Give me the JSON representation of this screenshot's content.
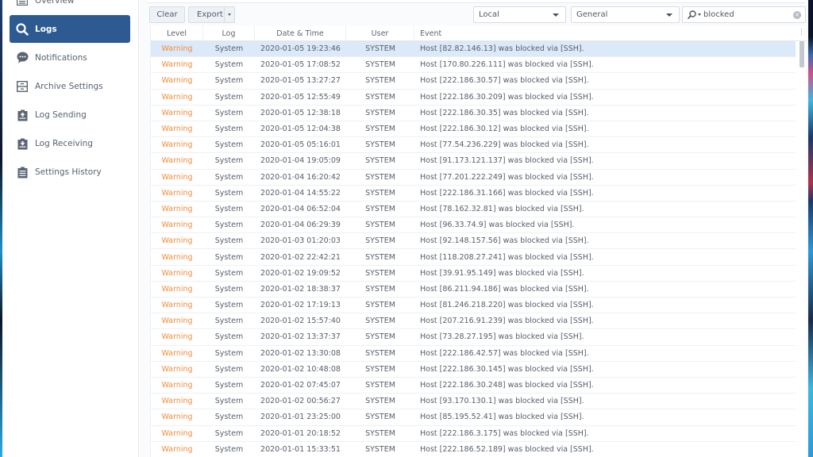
{
  "sidebar": {
    "items": [
      {
        "label": "Overview",
        "icon": "overview-icon",
        "active": false
      },
      {
        "label": "Logs",
        "icon": "search-icon",
        "active": true
      },
      {
        "label": "Notifications",
        "icon": "speech-bubble-icon",
        "active": false
      },
      {
        "label": "Archive Settings",
        "icon": "archive-drawer-icon",
        "active": false
      },
      {
        "label": "Log Sending",
        "icon": "clipboard-upload-icon",
        "active": false
      },
      {
        "label": "Log Receiving",
        "icon": "clipboard-download-icon",
        "active": false
      },
      {
        "label": "Settings History",
        "icon": "clipboard-list-icon",
        "active": false
      }
    ]
  },
  "toolbar": {
    "clear_label": "Clear",
    "export_label": "Export",
    "source_select": "Local",
    "type_select": "General",
    "search_value": "blocked",
    "search_placeholder": "Search"
  },
  "colors": {
    "accent": "#2c5a91",
    "warning": "#f08c3a",
    "selected_row": "#dce9f8"
  },
  "grid": {
    "columns": [
      "Level",
      "Log",
      "Date & Time",
      "User",
      "Event"
    ],
    "rows": [
      {
        "level": "Warning",
        "log": "System",
        "datetime": "2020-01-05 19:23:46",
        "user": "SYSTEM",
        "event": "Host [82.82.146.13] was blocked via [SSH]."
      },
      {
        "level": "Warning",
        "log": "System",
        "datetime": "2020-01-05 17:08:52",
        "user": "SYSTEM",
        "event": "Host [170.80.226.111] was blocked via [SSH]."
      },
      {
        "level": "Warning",
        "log": "System",
        "datetime": "2020-01-05 13:27:27",
        "user": "SYSTEM",
        "event": "Host [222.186.30.57] was blocked via [SSH]."
      },
      {
        "level": "Warning",
        "log": "System",
        "datetime": "2020-01-05 12:55:49",
        "user": "SYSTEM",
        "event": "Host [222.186.30.209] was blocked via [SSH]."
      },
      {
        "level": "Warning",
        "log": "System",
        "datetime": "2020-01-05 12:38:18",
        "user": "SYSTEM",
        "event": "Host [222.186.30.35] was blocked via [SSH]."
      },
      {
        "level": "Warning",
        "log": "System",
        "datetime": "2020-01-05 12:04:38",
        "user": "SYSTEM",
        "event": "Host [222.186.30.12] was blocked via [SSH]."
      },
      {
        "level": "Warning",
        "log": "System",
        "datetime": "2020-01-05 05:16:01",
        "user": "SYSTEM",
        "event": "Host [77.54.236.229] was blocked via [SSH]."
      },
      {
        "level": "Warning",
        "log": "System",
        "datetime": "2020-01-04 19:05:09",
        "user": "SYSTEM",
        "event": "Host [91.173.121.137] was blocked via [SSH]."
      },
      {
        "level": "Warning",
        "log": "System",
        "datetime": "2020-01-04 16:20:42",
        "user": "SYSTEM",
        "event": "Host [77.201.222.249] was blocked via [SSH]."
      },
      {
        "level": "Warning",
        "log": "System",
        "datetime": "2020-01-04 14:55:22",
        "user": "SYSTEM",
        "event": "Host [222.186.31.166] was blocked via [SSH]."
      },
      {
        "level": "Warning",
        "log": "System",
        "datetime": "2020-01-04 06:52:04",
        "user": "SYSTEM",
        "event": "Host [78.162.32.81] was blocked via [SSH]."
      },
      {
        "level": "Warning",
        "log": "System",
        "datetime": "2020-01-04 06:29:39",
        "user": "SYSTEM",
        "event": "Host [96.33.74.9] was blocked via [SSH]."
      },
      {
        "level": "Warning",
        "log": "System",
        "datetime": "2020-01-03 01:20:03",
        "user": "SYSTEM",
        "event": "Host [92.148.157.56] was blocked via [SSH]."
      },
      {
        "level": "Warning",
        "log": "System",
        "datetime": "2020-01-02 22:42:21",
        "user": "SYSTEM",
        "event": "Host [118.208.27.241] was blocked via [SSH]."
      },
      {
        "level": "Warning",
        "log": "System",
        "datetime": "2020-01-02 19:09:52",
        "user": "SYSTEM",
        "event": "Host [39.91.95.149] was blocked via [SSH]."
      },
      {
        "level": "Warning",
        "log": "System",
        "datetime": "2020-01-02 18:38:37",
        "user": "SYSTEM",
        "event": "Host [86.211.94.186] was blocked via [SSH]."
      },
      {
        "level": "Warning",
        "log": "System",
        "datetime": "2020-01-02 17:19:13",
        "user": "SYSTEM",
        "event": "Host [81.246.218.220] was blocked via [SSH]."
      },
      {
        "level": "Warning",
        "log": "System",
        "datetime": "2020-01-02 15:57:40",
        "user": "SYSTEM",
        "event": "Host [207.216.91.239] was blocked via [SSH]."
      },
      {
        "level": "Warning",
        "log": "System",
        "datetime": "2020-01-02 13:37:37",
        "user": "SYSTEM",
        "event": "Host [73.28.27.195] was blocked via [SSH]."
      },
      {
        "level": "Warning",
        "log": "System",
        "datetime": "2020-01-02 13:30:08",
        "user": "SYSTEM",
        "event": "Host [222.186.42.57] was blocked via [SSH]."
      },
      {
        "level": "Warning",
        "log": "System",
        "datetime": "2020-01-02 10:48:08",
        "user": "SYSTEM",
        "event": "Host [222.186.30.145] was blocked via [SSH]."
      },
      {
        "level": "Warning",
        "log": "System",
        "datetime": "2020-01-02 07:45:07",
        "user": "SYSTEM",
        "event": "Host [222.186.30.248] was blocked via [SSH]."
      },
      {
        "level": "Warning",
        "log": "System",
        "datetime": "2020-01-02 00:56:27",
        "user": "SYSTEM",
        "event": "Host [93.170.130.1] was blocked via [SSH]."
      },
      {
        "level": "Warning",
        "log": "System",
        "datetime": "2020-01-01 23:25:00",
        "user": "SYSTEM",
        "event": "Host [85.195.52.41] was blocked via [SSH]."
      },
      {
        "level": "Warning",
        "log": "System",
        "datetime": "2020-01-01 20:18:52",
        "user": "SYSTEM",
        "event": "Host [222.186.3.175] was blocked via [SSH]."
      },
      {
        "level": "Warning",
        "log": "System",
        "datetime": "2020-01-01 15:33:51",
        "user": "SYSTEM",
        "event": "Host [222.186.52.189] was blocked via [SSH]."
      }
    ]
  }
}
